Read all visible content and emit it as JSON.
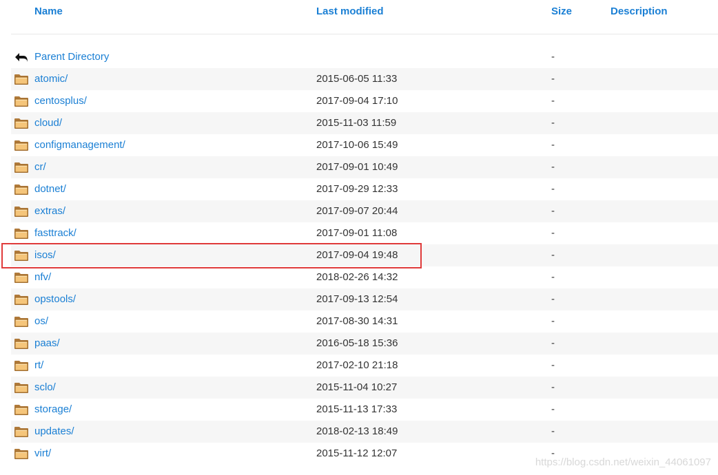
{
  "header": {
    "name_label": "Name",
    "modified_label": "Last modified",
    "size_label": "Size",
    "description_label": "Description"
  },
  "entries": [
    {
      "name": "Parent Directory",
      "modified": "",
      "size": "-",
      "icon": "back-arrow-icon"
    },
    {
      "name": "atomic/",
      "modified": "2015-06-05 11:33",
      "size": "-",
      "icon": "folder-icon"
    },
    {
      "name": "centosplus/",
      "modified": "2017-09-04 17:10",
      "size": "-",
      "icon": "folder-icon"
    },
    {
      "name": "cloud/",
      "modified": "2015-11-03 11:59",
      "size": "-",
      "icon": "folder-icon"
    },
    {
      "name": "configmanagement/",
      "modified": "2017-10-06 15:49",
      "size": "-",
      "icon": "folder-icon"
    },
    {
      "name": "cr/",
      "modified": "2017-09-01 10:49",
      "size": "-",
      "icon": "folder-icon"
    },
    {
      "name": "dotnet/",
      "modified": "2017-09-29 12:33",
      "size": "-",
      "icon": "folder-icon"
    },
    {
      "name": "extras/",
      "modified": "2017-09-07 20:44",
      "size": "-",
      "icon": "folder-icon"
    },
    {
      "name": "fasttrack/",
      "modified": "2017-09-01 11:08",
      "size": "-",
      "icon": "folder-icon"
    },
    {
      "name": "isos/",
      "modified": "2017-09-04 19:48",
      "size": "-",
      "icon": "folder-icon",
      "highlighted": true
    },
    {
      "name": "nfv/",
      "modified": "2018-02-26 14:32",
      "size": "-",
      "icon": "folder-icon"
    },
    {
      "name": "opstools/",
      "modified": "2017-09-13 12:54",
      "size": "-",
      "icon": "folder-icon"
    },
    {
      "name": "os/",
      "modified": "2017-08-30 14:31",
      "size": "-",
      "icon": "folder-icon"
    },
    {
      "name": "paas/",
      "modified": "2016-05-18 15:36",
      "size": "-",
      "icon": "folder-icon"
    },
    {
      "name": "rt/",
      "modified": "2017-02-10 21:18",
      "size": "-",
      "icon": "folder-icon"
    },
    {
      "name": "sclo/",
      "modified": "2015-11-04 10:27",
      "size": "-",
      "icon": "folder-icon"
    },
    {
      "name": "storage/",
      "modified": "2015-11-13 17:33",
      "size": "-",
      "icon": "folder-icon"
    },
    {
      "name": "updates/",
      "modified": "2018-02-13 18:49",
      "size": "-",
      "icon": "folder-icon"
    },
    {
      "name": "virt/",
      "modified": "2015-11-12 12:07",
      "size": "-",
      "icon": "folder-icon"
    }
  ],
  "watermark": "https://blog.csdn.net/weixin_44061097",
  "colors": {
    "link": "#1a7fd4",
    "highlight_border": "#e03a3a",
    "row_alt": "#f6f6f6",
    "folder_fill": "#f5c57a"
  }
}
